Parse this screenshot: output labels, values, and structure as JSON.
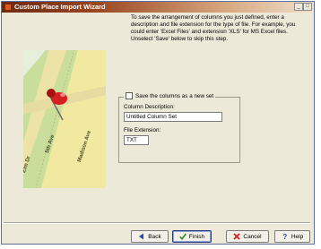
{
  "window": {
    "title": "Custom Place Import Wizard",
    "title_buttons": {
      "minimize": "_",
      "maximize": "□"
    }
  },
  "map": {
    "street_labels": [
      "Elm Dr",
      "5th Ave",
      "Madison Ave"
    ],
    "pin_color": "#d42020"
  },
  "instructions": {
    "text": "To save the arrangement of columns you just defined, enter a description and file extension for the type of file. For example, you could enter 'Excel Files' and extension 'XLS' for MS Excel files. Unselect 'Save' below to skip this step."
  },
  "save_group": {
    "checkbox_label": "Save the columns as a new set",
    "checked": false,
    "description_label": "Column Description:",
    "description_value": "Untitled Column Set",
    "extension_label": "File Extension:",
    "extension_value": "TXT"
  },
  "buttons": {
    "back": "Back",
    "finish": "Finish",
    "cancel": "Cancel",
    "help": "Help"
  },
  "colors": {
    "title_gradient_start": "#6d2a12",
    "dialog_bg": "#ece9d8",
    "map_green": "#c8de9a",
    "road_yellow": "#f2e9a0"
  },
  "icons": {
    "title": "wizard-app-icon",
    "back": "arrow-left-icon",
    "finish": "checkmark-icon",
    "cancel": "red-x-icon",
    "help": "question-mark-icon"
  }
}
